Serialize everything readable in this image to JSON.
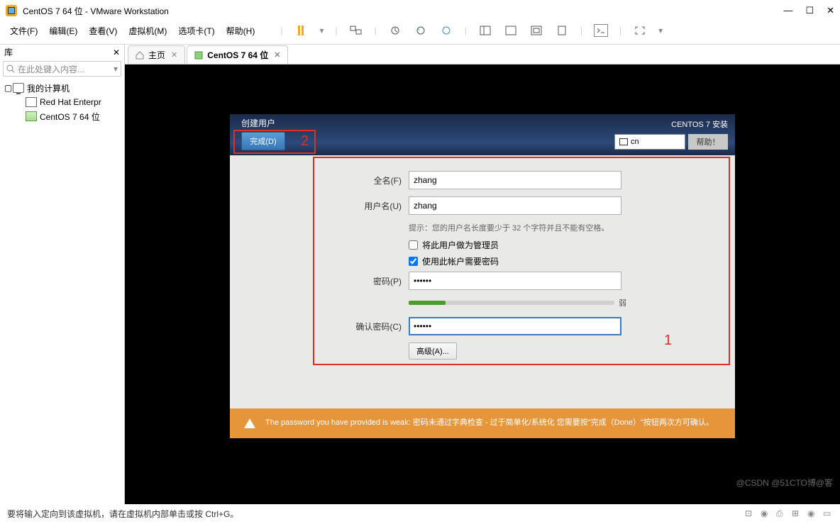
{
  "title": "CentOS 7 64 位 - VMware Workstation",
  "menu": {
    "file": "文件(F)",
    "edit": "编辑(E)",
    "view": "查看(V)",
    "vm": "虚拟机(M)",
    "tabs": "选项卡(T)",
    "help": "帮助(H)"
  },
  "library": {
    "header": "库",
    "search_placeholder": "在此处键入内容...",
    "root": "我的计算机",
    "item1": "Red Hat Enterpr",
    "item2": "CentOS 7 64 位"
  },
  "tabs": {
    "home": "主页",
    "vm": "CentOS 7 64 位"
  },
  "installer": {
    "title": "创建用户",
    "done": "完成(D)",
    "subtitle": "CENTOS 7 安装",
    "locale": "cn",
    "help": "帮助！",
    "fullname_label": "全名(F)",
    "fullname_value": "zhang",
    "username_label": "用户名(U)",
    "username_value": "zhang",
    "hint": "提示：您的用户名长度要少于 32 个字符并且不能有空格。",
    "admin_label": "将此用户做为管理员",
    "reqpass_label": "使用此帐户需要密码",
    "password_label": "密码(P)",
    "password_value": "••••••",
    "strength": "弱",
    "confirm_label": "确认密码(C)",
    "confirm_value": "••••••",
    "advanced": "高级(A)...",
    "warning": "The password you have provided is weak: 密码未通过字典检查 - 过于简单化/系统化 您需要按\"完成（Done）\"按钮两次方可确认。"
  },
  "annotations": {
    "one": "1",
    "two": "2"
  },
  "statusbar": "要将输入定向到该虚拟机，请在虚拟机内部单击或按 Ctrl+G。",
  "watermark": "@CSDN @51CTO博@客"
}
